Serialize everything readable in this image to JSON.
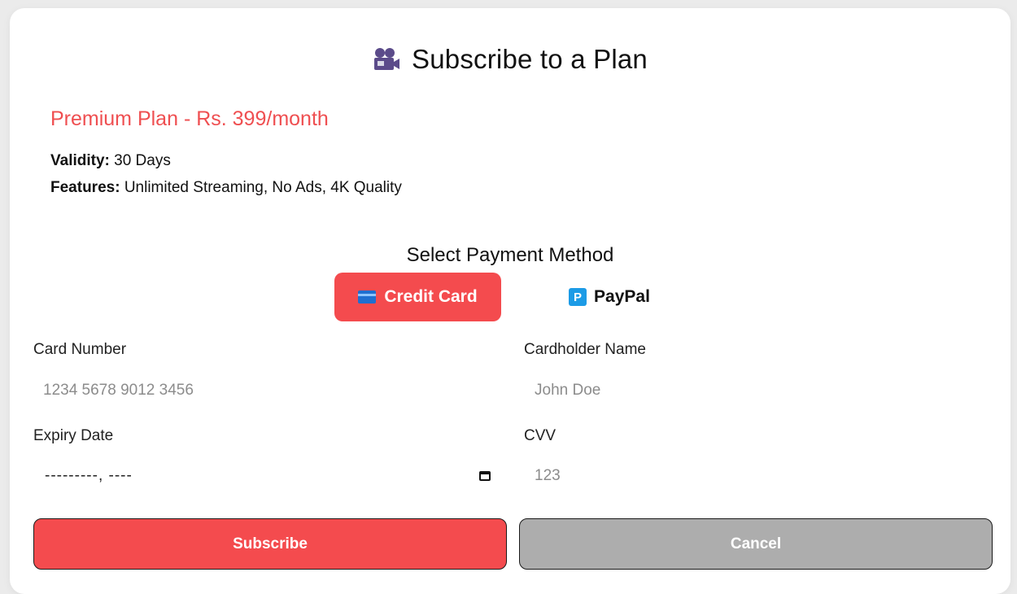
{
  "header": {
    "title": "Subscribe to a Plan",
    "icon": "movie-camera-icon"
  },
  "plan": {
    "name": "Premium Plan - Rs. 399/month",
    "validity_label": "Validity:",
    "validity_value": "30 Days",
    "features_label": "Features:",
    "features_value": "Unlimited Streaming, No Ads, 4K Quality"
  },
  "payment": {
    "heading": "Select Payment Method",
    "credit_label": "Credit Card",
    "paypal_label": "PayPal",
    "paypal_icon_letter": "P",
    "selected": "Credit Card"
  },
  "form": {
    "card_number_label": "Card Number",
    "card_number_placeholder": "1234 5678 9012 3456",
    "cardholder_label": "Cardholder Name",
    "cardholder_placeholder": "John Doe",
    "expiry_label": "Expiry Date",
    "expiry_placeholder": "---------, ----",
    "cvv_label": "CVV",
    "cvv_placeholder": "123"
  },
  "actions": {
    "subscribe_label": "Subscribe",
    "cancel_label": "Cancel"
  },
  "colors": {
    "accent": "#f44b4e",
    "cancel": "#adadad",
    "plan_name": "#ef4f51"
  }
}
